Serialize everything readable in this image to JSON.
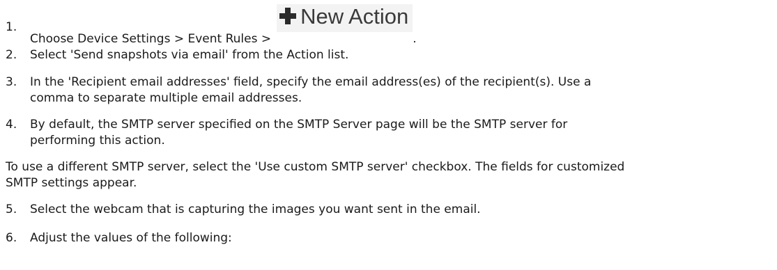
{
  "steps": [
    {
      "num": "1.",
      "text": "Choose Device Settings > Event Rules >",
      "button_label": "New Action",
      "suffix": "."
    },
    {
      "num": "2.",
      "text": "Select 'Send snapshots via email' from the Action list."
    },
    {
      "num": "3.",
      "line1": "In the 'Recipient email addresses' field, specify the email address(es) of the recipient(s). Use a",
      "line2": "comma to separate multiple email addresses."
    },
    {
      "num": "4.",
      "line1": "By default, the SMTP server specified on the SMTP Server page will be the SMTP server for",
      "line2": "performing this action."
    },
    {
      "num": "5.",
      "text": "Select the webcam that is capturing the images you want sent in the email."
    },
    {
      "num": "6.",
      "text": "Adjust the values of the following:"
    }
  ],
  "note": {
    "line1": "To use a different SMTP server, select the 'Use custom SMTP server' checkbox. The fields for customized",
    "line2": "SMTP settings appear."
  },
  "icons": {
    "new_action": "plus-icon"
  }
}
